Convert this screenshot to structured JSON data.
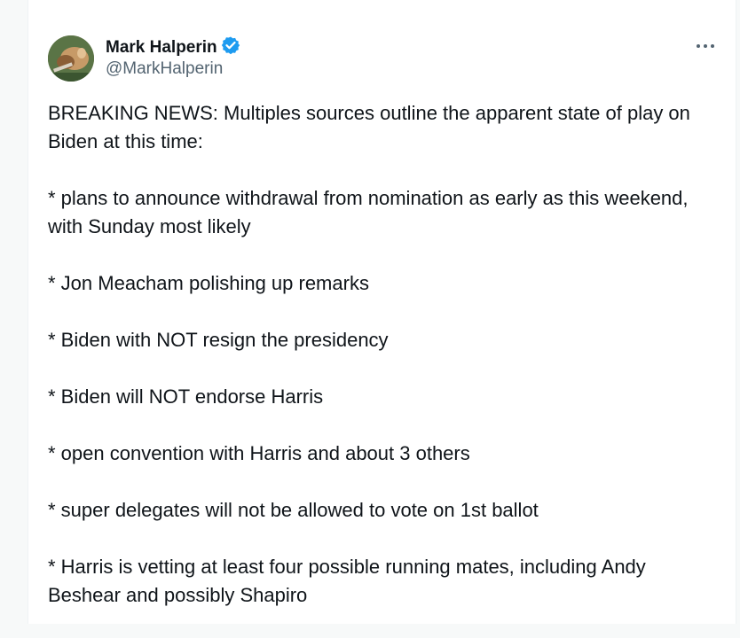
{
  "tweet": {
    "author_name": "Mark Halperin",
    "handle": "@MarkHalperin",
    "verified_icon": "verified-badge-icon",
    "more_icon": "more-options-icon",
    "paragraphs": [
      "BREAKING NEWS: Multiples sources outline the apparent state of play on Biden at this time:",
      "* plans to announce withdrawal from nomination as early as this weekend, with Sunday most likely",
      "* Jon Meacham polishing up remarks",
      "* Biden with NOT resign the presidency",
      "* Biden will NOT endorse Harris",
      "* open convention with Harris and about 3 others",
      "* super delegates will not be allowed to vote on 1st ballot",
      "* Harris is vetting at least four possible running mates, including Andy Beshear and possibly Shapiro"
    ]
  },
  "colors": {
    "text": "#0f1419",
    "secondary": "#536471",
    "verified": "#1d9bf0"
  }
}
